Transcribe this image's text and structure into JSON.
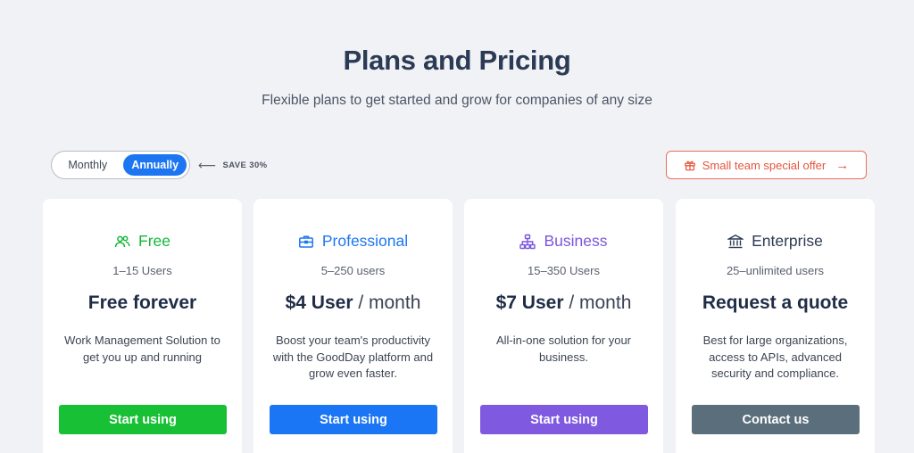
{
  "header": {
    "title": "Plans and Pricing",
    "subtitle": "Flexible plans to get started and grow for companies of any size"
  },
  "billing_toggle": {
    "monthly_label": "Monthly",
    "annually_label": "Annually",
    "selected": "Annually",
    "save_note": "SAVE 30%"
  },
  "offer": {
    "label": "Small team special offer",
    "icon": "gift-icon",
    "color": "#e4553f"
  },
  "plans": [
    {
      "name": "Free",
      "icon": "users-icon",
      "color": "#14b83a",
      "users": "1–15 Users",
      "price": "Free forever",
      "per": "",
      "description": "Work Management Solution to get you up and running",
      "button": "Start using",
      "button_color": "#17c035"
    },
    {
      "name": "Professional",
      "icon": "briefcase-icon",
      "color": "#1c76f2",
      "users": "5–250 users",
      "price": "$4 User",
      "per": "/ month",
      "description": "Boost your team's productivity with the GoodDay platform and grow even faster.",
      "button": "Start using",
      "button_color": "#1b76f5"
    },
    {
      "name": "Business",
      "icon": "hierarchy-icon",
      "color": "#7b55dd",
      "users": "15–350 Users",
      "price": "$7 User",
      "per": "/ month",
      "description": "All-in-one solution for your business.",
      "button": "Start using",
      "button_color": "#7f5ae0"
    },
    {
      "name": "Enterprise",
      "icon": "bank-icon",
      "color": "#2d3a52",
      "users": "25–unlimited users",
      "price": "Request a quote",
      "per": "",
      "description": "Best for large organizations, access to APIs, advanced security and compliance.",
      "button": "Contact us",
      "button_color": "#5b6e7b"
    }
  ]
}
